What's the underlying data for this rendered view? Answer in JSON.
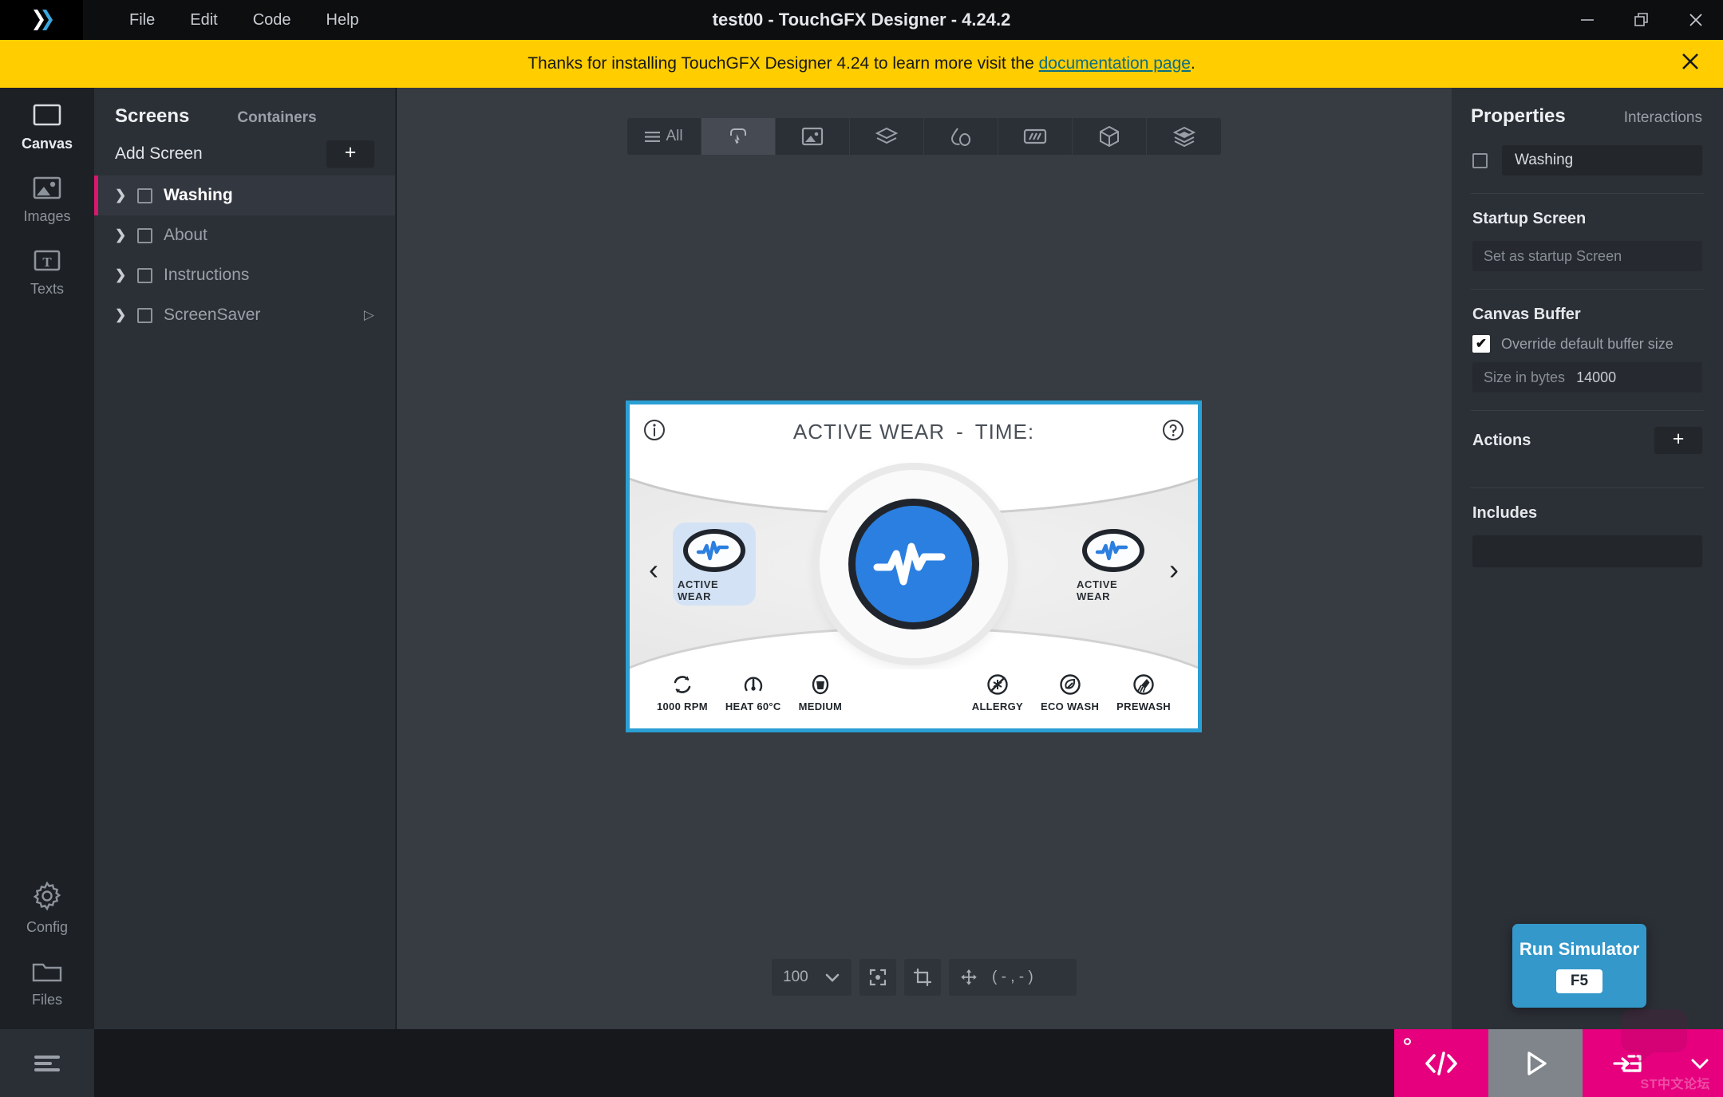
{
  "window": {
    "title": "test00 - TouchGFX Designer - 4.24.2",
    "minimize": "–",
    "maximize": "❐",
    "close": "✕"
  },
  "menu": {
    "items": [
      {
        "label": "File"
      },
      {
        "label": "Edit"
      },
      {
        "label": "Code"
      },
      {
        "label": "Help"
      }
    ]
  },
  "notification": {
    "text_before": "Thanks for installing TouchGFX Designer 4.24 to learn more visit the ",
    "link_label": "documentation page",
    "text_after": ".",
    "close_label": "✕",
    "background": "#ffcd00"
  },
  "rail": {
    "items": [
      {
        "label": "Canvas",
        "icon": "canvas-icon",
        "active": true
      },
      {
        "label": "Images",
        "icon": "images-icon",
        "active": false
      },
      {
        "label": "Texts",
        "icon": "texts-icon",
        "active": false
      }
    ],
    "bottom_items": [
      {
        "label": "Config",
        "icon": "gear-icon"
      },
      {
        "label": "Files",
        "icon": "folder-icon"
      }
    ],
    "hamburger_icon": "hamburger-icon"
  },
  "screens_panel": {
    "tab_active": "Screens",
    "tab_other": "Containers",
    "add_screen_label": "Add Screen",
    "add_button_label": "+",
    "screens": [
      {
        "name": "Washing",
        "selected": true,
        "has_play": false
      },
      {
        "name": "About",
        "selected": false,
        "has_play": false
      },
      {
        "name": "Instructions",
        "selected": false,
        "has_play": false
      },
      {
        "name": "ScreenSaver",
        "selected": false,
        "has_play": true
      }
    ],
    "accent": "#d6196e"
  },
  "canvas_toolbar": {
    "filter_label": "All",
    "buttons": [
      {
        "name": "filter-all",
        "icon": "hamburger-icon",
        "selected": false
      },
      {
        "name": "widget-button",
        "icon": "button-click-icon",
        "selected": true
      },
      {
        "name": "widget-image",
        "icon": "image-icon",
        "selected": false
      },
      {
        "name": "widget-container",
        "icon": "layers-icon",
        "selected": false
      },
      {
        "name": "widget-shape",
        "icon": "shapes-icon",
        "selected": false
      },
      {
        "name": "widget-gauge",
        "icon": "progress-icon",
        "selected": false
      },
      {
        "name": "widget-3d",
        "icon": "cube-icon",
        "selected": false
      },
      {
        "name": "widget-custom",
        "icon": "layers-alt-icon",
        "selected": false
      }
    ]
  },
  "device_preview": {
    "border_color": "#2a9fd3",
    "header": {
      "info_icon": "info-icon",
      "help_icon": "help-icon",
      "program_name": "ACTIVE WEAR",
      "separator": "-",
      "time_label": "TIME:"
    },
    "carousel": {
      "prev_arrow": "‹",
      "next_arrow": "›",
      "left_item_label": "ACTIVE WEAR",
      "right_item_label": "ACTIVE WEAR",
      "center_icon": "pulse-icon",
      "center_color": "#2b7fe0"
    },
    "footer_left": [
      {
        "icon": "spin-icon",
        "label": "1000 RPM"
      },
      {
        "icon": "temperature-icon",
        "label": "HEAT 60°C"
      },
      {
        "icon": "load-icon",
        "label": "MEDIUM"
      }
    ],
    "footer_right": [
      {
        "icon": "allergy-icon",
        "label": "ALLERGY"
      },
      {
        "icon": "eco-icon",
        "label": "ECO WASH"
      },
      {
        "icon": "prewash-icon",
        "label": "PREWASH"
      }
    ]
  },
  "zoom_bar": {
    "zoom_value": "100",
    "dropdown_icon": "chevron-down-icon",
    "fit_icon": "fit-to-screen-icon",
    "crop_icon": "crop-icon",
    "move_icon": "move-icon",
    "coordinates": "( - , - )"
  },
  "properties": {
    "tab_active": "Properties",
    "tab_other": "Interactions",
    "name_value": "Washing",
    "startup_section": "Startup Screen",
    "startup_button": "Set as startup Screen",
    "canvas_buffer_section": "Canvas Buffer",
    "override_checkbox_label": "Override default buffer size",
    "override_checked": true,
    "size_label": "Size in bytes",
    "size_value": "14000",
    "actions_section": "Actions",
    "actions_add": "+",
    "includes_section": "Includes",
    "includes_value": ""
  },
  "run_simulator": {
    "label": "Run Simulator",
    "shortcut": "F5",
    "background": "#3498ca"
  },
  "bottom_run_group": {
    "generate_code_icon": "code-icon",
    "run_icon": "play-icon",
    "run_target_icon": "run-target-icon",
    "caret_icon": "chevron-down-icon",
    "pink": "#e6007e"
  },
  "watermark": {
    "text": "ST中文论坛"
  }
}
